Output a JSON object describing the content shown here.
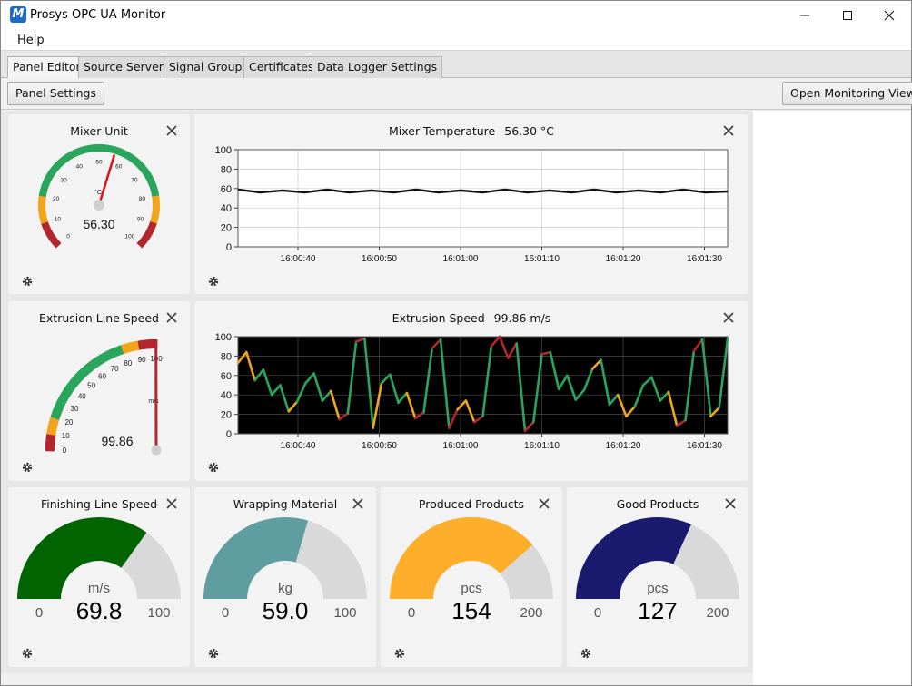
{
  "window": {
    "title": "Prosys OPC UA Monitor",
    "icon_letter": "M",
    "controls": [
      "minimize-icon",
      "maximize-icon",
      "close-icon"
    ]
  },
  "menu": {
    "items": [
      {
        "label": "Help"
      }
    ]
  },
  "tabs": [
    {
      "label": "Panel Editor",
      "active": true
    },
    {
      "label": "Source Servers"
    },
    {
      "label": "Signal Groups"
    },
    {
      "label": "Certificates"
    },
    {
      "label": "Data Logger Settings"
    }
  ],
  "toolbar": {
    "panel_settings_label": "Panel Settings",
    "open_monitoring_label": "Open Monitoring View"
  },
  "colors": {
    "green": "#2aa55c",
    "orange": "#f2a51a",
    "red": "#b3262e",
    "gray_track": "#d9d9d9",
    "dark_green": "#006400",
    "teal": "#5f9ea0",
    "amber": "#fdae2a",
    "navy": "#1a1a6e"
  },
  "panels": {
    "mixer_unit": {
      "title": "Mixer Unit",
      "value_text": "56.30",
      "unit": "°C",
      "value": 56.3,
      "min": 0,
      "max": 100,
      "ticks": [
        "0",
        "10",
        "20",
        "30",
        "40",
        "50",
        "60",
        "70",
        "80",
        "90",
        "100"
      ]
    },
    "mixer_temperature": {
      "title": "Mixer Temperature",
      "value_text": "56.30 °C",
      "chart_data": {
        "type": "line",
        "ylim": [
          0,
          100
        ],
        "y_ticks": [
          "100",
          "80",
          "60",
          "40",
          "20",
          "0"
        ],
        "x_ticks": [
          "16:00:40",
          "16:00:50",
          "16:01:00",
          "16:01:10",
          "16:01:20",
          "16:01:30"
        ],
        "values": [
          59,
          56,
          58,
          56,
          59,
          56,
          58,
          56,
          59,
          56,
          58,
          56,
          59,
          56,
          58,
          56,
          59,
          56,
          58,
          56,
          59,
          56,
          57
        ]
      }
    },
    "extrusion_line_speed": {
      "title": "Extrusion Line Speed",
      "value_text": "99.86",
      "unit": "m/s",
      "value": 99.86,
      "min": 0,
      "max": 100,
      "ticks": [
        "0",
        "10",
        "20",
        "30",
        "40",
        "50",
        "60",
        "70",
        "80",
        "90",
        "100"
      ]
    },
    "extrusion_speed": {
      "title": "Extrusion Speed",
      "value_text": "99.86 m/s",
      "chart_data": {
        "type": "line",
        "ylim": [
          0,
          100
        ],
        "y_ticks": [
          "100",
          "80",
          "60",
          "40",
          "20",
          "0"
        ],
        "x_ticks": [
          "16:00:40",
          "16:00:50",
          "16:01:00",
          "16:01:10",
          "16:01:20",
          "16:01:30"
        ],
        "values": [
          73,
          84,
          55,
          66,
          40,
          50,
          23,
          33,
          52,
          62,
          34,
          44,
          15,
          21,
          95,
          98,
          6,
          52,
          61,
          32,
          42,
          16,
          22,
          88,
          97,
          6,
          25,
          34,
          12,
          18,
          90,
          100,
          78,
          93,
          3,
          12,
          82,
          84,
          46,
          60,
          35,
          45,
          67,
          76,
          30,
          40,
          18,
          28,
          50,
          58,
          34,
          43,
          8,
          14,
          85,
          97,
          18,
          27,
          98
        ]
      }
    },
    "finishing_line_speed": {
      "title": "Finishing Line Speed",
      "unit": "m/s",
      "value_text": "69.8",
      "value": 69.8,
      "min_label": "0",
      "max_label": "100",
      "min": 0,
      "max": 100
    },
    "wrapping_material": {
      "title": "Wrapping Material",
      "unit": "kg",
      "value_text": "59.0",
      "value": 59.0,
      "min_label": "0",
      "max_label": "100",
      "min": 0,
      "max": 100
    },
    "produced_products": {
      "title": "Produced Products",
      "unit": "pcs",
      "value_text": "154",
      "value": 154,
      "min_label": "0",
      "max_label": "200",
      "min": 0,
      "max": 200
    },
    "good_products": {
      "title": "Good Products",
      "unit": "pcs",
      "value_text": "127",
      "value": 127,
      "min_label": "0",
      "max_label": "200",
      "min": 0,
      "max": 200
    }
  }
}
